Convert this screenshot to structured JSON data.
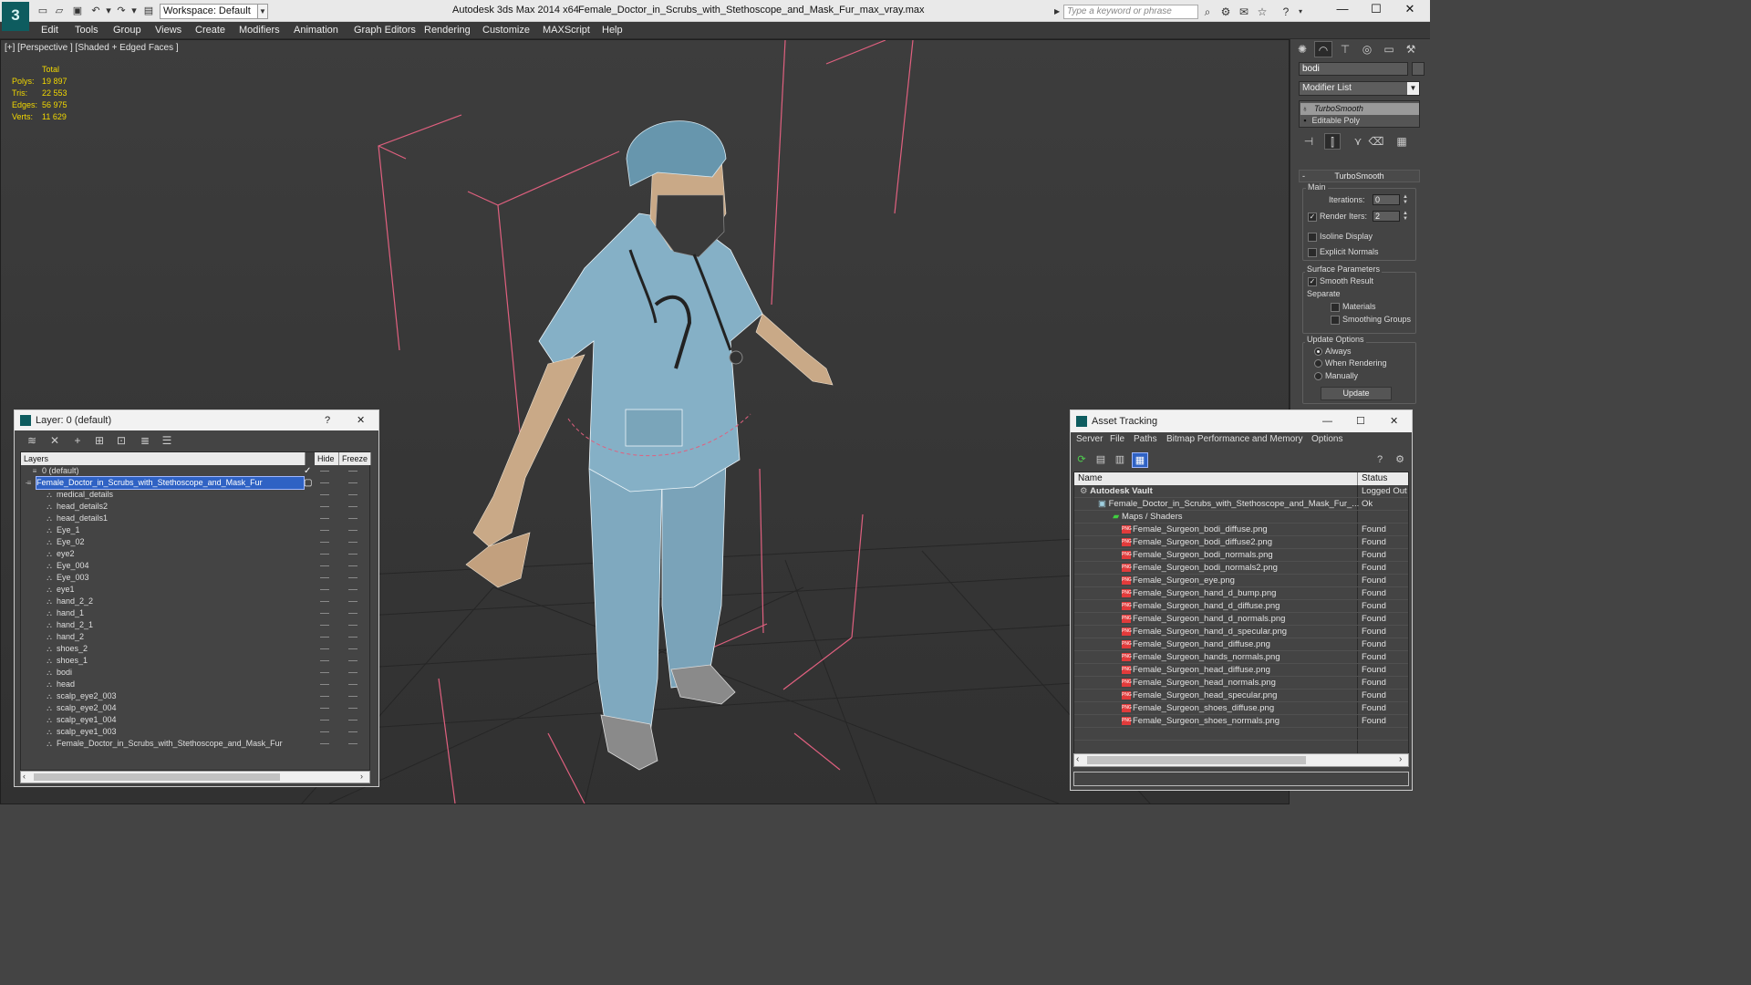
{
  "titlebar": {
    "logo_glyph": "3",
    "workspace_label": "Workspace: Default",
    "app_title": "Autodesk 3ds Max  2014 x64",
    "file_title": "Female_Doctor_in_Scrubs_with_Stethoscope_and_Mask_Fur_max_vray.max",
    "search_placeholder": "Type a keyword or phrase",
    "window_controls": {
      "minimize": "—",
      "maximize": "☐",
      "close": "✕"
    }
  },
  "menubar": {
    "items": [
      "Edit",
      "Tools",
      "Group",
      "Views",
      "Create",
      "Modifiers",
      "Animation",
      "Graph Editors",
      "Rendering",
      "Customize",
      "MAXScript",
      "Help"
    ]
  },
  "viewport": {
    "label": "[+] [Perspective ] [Shaded + Edged Faces ]",
    "stats": {
      "header": "Total",
      "rows": [
        {
          "label": "Polys:",
          "value": "19 897"
        },
        {
          "label": "Tris:",
          "value": "22 553"
        },
        {
          "label": "Edges:",
          "value": "56 975"
        },
        {
          "label": "Verts:",
          "value": "11 629"
        }
      ]
    }
  },
  "command_panel": {
    "object_name": "bodi",
    "modifier_list": "Modifier List",
    "stack": [
      "TurboSmooth",
      "Editable Poly"
    ],
    "rollout_title": "TurboSmooth",
    "main_label": "Main",
    "iterations_label": "Iterations:",
    "iterations_value": "0",
    "render_iters_label": "Render Iters:",
    "render_iters_value": "2",
    "isoline_label": "Isoline Display",
    "explicit_normals_label": "Explicit Normals",
    "surface_params_label": "Surface Parameters",
    "smooth_result_label": "Smooth Result",
    "separate_label": "Separate",
    "materials_label": "Materials",
    "smoothing_groups_label": "Smoothing Groups",
    "update_options_label": "Update Options",
    "always_label": "Always",
    "when_rendering_label": "When Rendering",
    "manually_label": "Manually",
    "update_button": "Update"
  },
  "layer_window": {
    "title": "Layer: 0 (default)",
    "help": "?",
    "close": "✕",
    "columns": [
      "Layers",
      "Hide",
      "Freeze"
    ],
    "rows": [
      {
        "name": "0 (default)",
        "level": 0
      },
      {
        "name": "Female_Doctor_in_Scrubs_with_Stethoscope_and_Mask_Fur",
        "level": 0
      },
      {
        "name": "medical_details",
        "level": 1
      },
      {
        "name": "head_details2",
        "level": 1
      },
      {
        "name": "head_details1",
        "level": 1
      },
      {
        "name": "Eye_1",
        "level": 1
      },
      {
        "name": "Eye_02",
        "level": 1
      },
      {
        "name": "eye2",
        "level": 1
      },
      {
        "name": "Eye_004",
        "level": 1
      },
      {
        "name": "Eye_003",
        "level": 1
      },
      {
        "name": "eye1",
        "level": 1
      },
      {
        "name": "hand_2_2",
        "level": 1
      },
      {
        "name": "hand_1",
        "level": 1
      },
      {
        "name": "hand_2_1",
        "level": 1
      },
      {
        "name": "hand_2",
        "level": 1
      },
      {
        "name": "shoes_2",
        "level": 1
      },
      {
        "name": "shoes_1",
        "level": 1
      },
      {
        "name": "bodi",
        "level": 1
      },
      {
        "name": "head",
        "level": 1
      },
      {
        "name": "scalp_eye2_003",
        "level": 1
      },
      {
        "name": "scalp_eye2_004",
        "level": 1
      },
      {
        "name": "scalp_eye1_004",
        "level": 1
      },
      {
        "name": "scalp_eye1_003",
        "level": 1
      },
      {
        "name": "Female_Doctor_in_Scrubs_with_Stethoscope_and_Mask_Fur",
        "level": 1
      }
    ]
  },
  "asset_window": {
    "title": "Asset Tracking",
    "controls": {
      "minimize": "—",
      "maximize": "☐",
      "close": "✕"
    },
    "menu": [
      "Server",
      "File",
      "Paths",
      "Bitmap Performance and Memory",
      "Options"
    ],
    "columns": [
      "Name",
      "Status"
    ],
    "vault": {
      "name": "Autodesk Vault",
      "status": "Logged Out"
    },
    "max_file": {
      "name": "Female_Doctor_in_Scrubs_with_Stethoscope_and_Mask_Fur_...",
      "status": "Ok"
    },
    "maps_label": "Maps / Shaders",
    "png_label": "PNG",
    "files": [
      {
        "name": "Female_Surgeon_bodi_diffuse.png",
        "status": "Found"
      },
      {
        "name": "Female_Surgeon_bodi_diffuse2.png",
        "status": "Found"
      },
      {
        "name": "Female_Surgeon_bodi_normals.png",
        "status": "Found"
      },
      {
        "name": "Female_Surgeon_bodi_normals2.png",
        "status": "Found"
      },
      {
        "name": "Female_Surgeon_eye.png",
        "status": "Found"
      },
      {
        "name": "Female_Surgeon_hand_d_bump.png",
        "status": "Found"
      },
      {
        "name": "Female_Surgeon_hand_d_diffuse.png",
        "status": "Found"
      },
      {
        "name": "Female_Surgeon_hand_d_normals.png",
        "status": "Found"
      },
      {
        "name": "Female_Surgeon_hand_d_specular.png",
        "status": "Found"
      },
      {
        "name": "Female_Surgeon_hand_diffuse.png",
        "status": "Found"
      },
      {
        "name": "Female_Surgeon_hands_normals.png",
        "status": "Found"
      },
      {
        "name": "Female_Surgeon_head_diffuse.png",
        "status": "Found"
      },
      {
        "name": "Female_Surgeon_head_normals.png",
        "status": "Found"
      },
      {
        "name": "Female_Surgeon_head_specular.png",
        "status": "Found"
      },
      {
        "name": "Female_Surgeon_shoes_diffuse.png",
        "status": "Found"
      },
      {
        "name": "Female_Surgeon_shoes_normals.png",
        "status": "Found"
      }
    ]
  },
  "colors": {
    "viewport_bg": "#383838",
    "scrubs": "#7fa9bf",
    "skin": "#c9a987",
    "selection": "#2f62c4",
    "bbox_lines": "#e0607f",
    "stats_text": "#f2d800"
  }
}
